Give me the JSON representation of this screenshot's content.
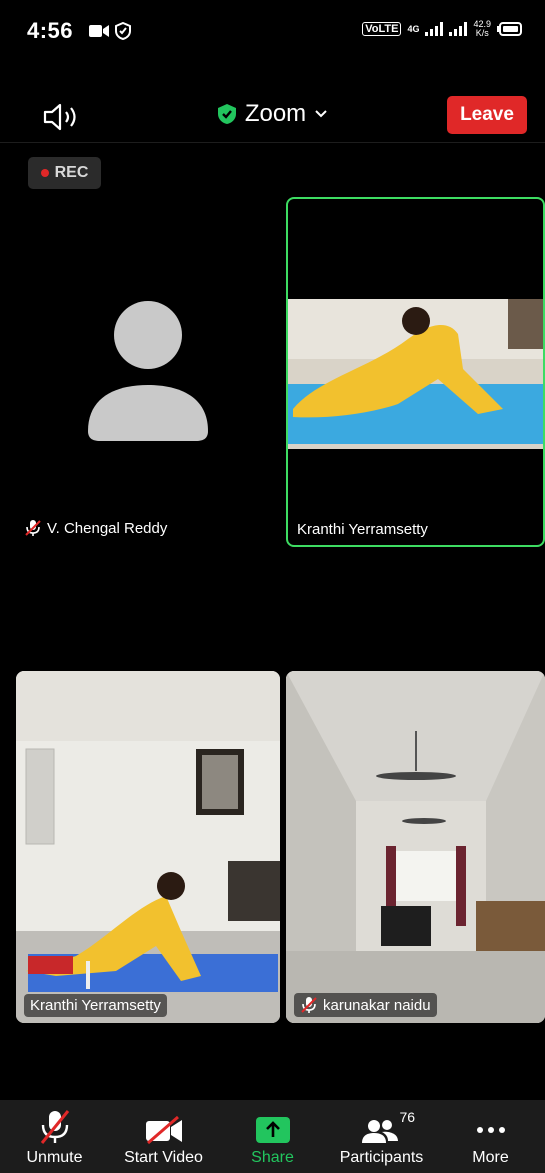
{
  "status": {
    "time": "4:56",
    "network": "VoLTE",
    "gen": "4G",
    "speed_value": "42.9",
    "speed_unit": "K/s"
  },
  "header": {
    "title": "Zoom",
    "leave_label": "Leave"
  },
  "recording": {
    "label": "REC"
  },
  "participants_tiles": [
    {
      "name": "V. Chengal Reddy",
      "muted": true,
      "video": false
    },
    {
      "name": "Kranthi Yerramsetty",
      "muted": false,
      "video": true,
      "active_speaker": true
    },
    {
      "name": "Kranthi Yerramsetty",
      "muted": false,
      "video": true
    },
    {
      "name": "karunakar naidu",
      "muted": true,
      "video": true
    }
  ],
  "toolbar": {
    "unmute_label": "Unmute",
    "start_video_label": "Start Video",
    "share_label": "Share",
    "participants_label": "Participants",
    "participants_count": "76",
    "more_label": "More"
  },
  "colors": {
    "accent_green": "#22c55e",
    "leave_red": "#e02828",
    "active_border": "#3ddc62"
  }
}
